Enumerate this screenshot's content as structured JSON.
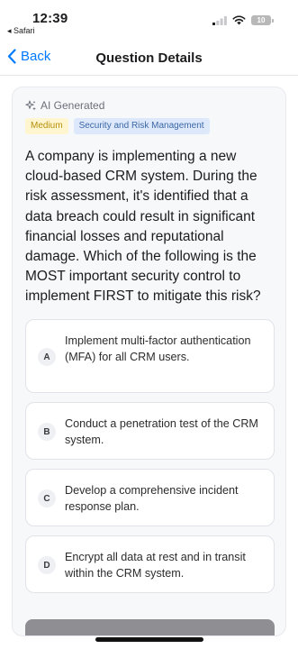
{
  "status_bar": {
    "time": "12:39",
    "back_app": "◂ Safari",
    "battery": "10"
  },
  "nav": {
    "back_label": "Back",
    "title": "Question Details"
  },
  "card": {
    "ai_label": "AI Generated",
    "tags": {
      "difficulty": "Medium",
      "domain": "Security and Risk Management"
    },
    "question": "A company is implementing a new cloud-based CRM system. During the risk assessment, it's identified that a data breach could result in significant financial losses and reputational damage. Which of the following is the MOST important security control to implement FIRST to mitigate this risk?",
    "options": [
      {
        "letter": "A",
        "text": "Implement multi-factor authentication (MFA) for all CRM users."
      },
      {
        "letter": "B",
        "text": "Conduct a penetration test of the CRM system."
      },
      {
        "letter": "C",
        "text": "Develop a comprehensive incident response plan."
      },
      {
        "letter": "D",
        "text": "Encrypt all data at rest and in transit within the CRM system."
      }
    ]
  },
  "colors": {
    "accent": "#007aff",
    "difficulty_bg": "#fff6cf",
    "domain_bg": "#dde9fa"
  }
}
